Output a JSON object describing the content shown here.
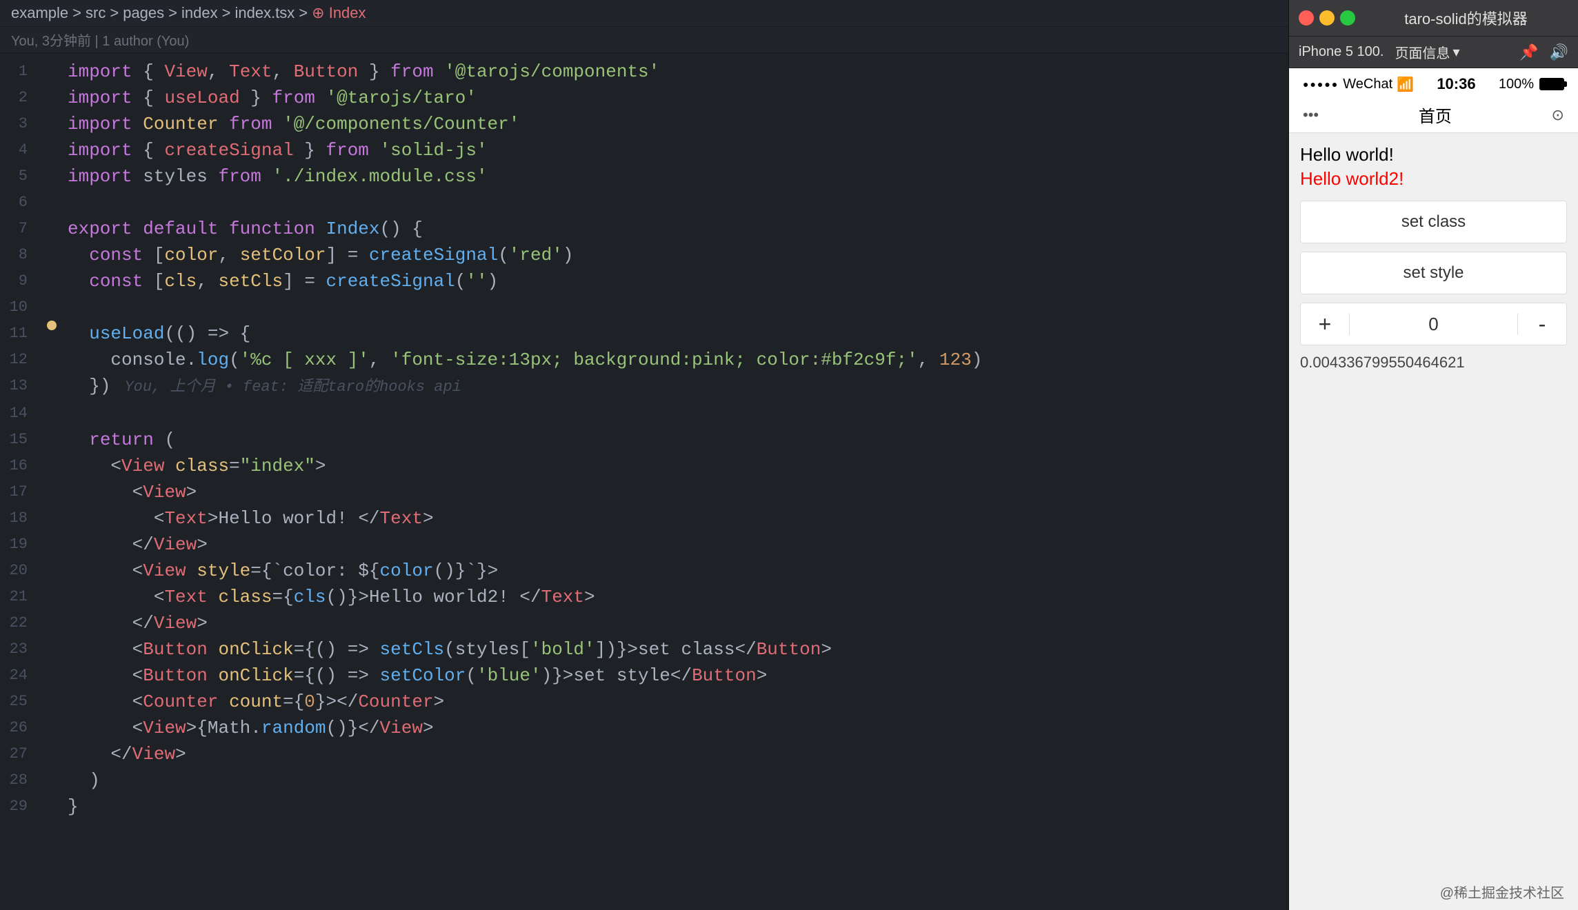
{
  "editor": {
    "breadcrumb": {
      "parts": [
        "example",
        "src",
        "pages",
        "index",
        "index.tsx",
        "Index"
      ],
      "active": "Index"
    },
    "git_info": "You, 3分钟前 | 1 author (You)",
    "lines": [
      {
        "num": "",
        "content": "import { View, Text, Button } from '@tarojs/components'",
        "type": "import"
      },
      {
        "num": "",
        "content": "import { useLoad } from '@tarojs/taro'",
        "type": "import"
      },
      {
        "num": "",
        "content": "import Counter from '@/components/Counter'",
        "type": "import"
      },
      {
        "num": "",
        "content": "import { createSignal } from 'solid-js'",
        "type": "import"
      },
      {
        "num": "",
        "content": "import styles from './index.module.css'",
        "type": "import"
      },
      {
        "num": "",
        "content": "",
        "type": "empty"
      },
      {
        "num": "",
        "content": "export default function Index() {",
        "type": "code"
      },
      {
        "num": "",
        "content": "  const [color, setColor] = createSignal('red')",
        "type": "code"
      },
      {
        "num": "",
        "content": "  const [cls, setCls] = createSignal('')",
        "type": "code"
      },
      {
        "num": "",
        "content": "",
        "type": "empty"
      },
      {
        "num": "",
        "content": "  useLoad(() => {",
        "type": "code",
        "has_dot": true
      },
      {
        "num": "",
        "content": "    console.log('%c [ xxx ]', 'font-size:13px; background:pink; color:#bf2c9f;', 123)",
        "type": "code"
      },
      {
        "num": "",
        "content": "  })",
        "type": "code",
        "blame": "You, 上个月 • feat: 适配taro的hooks api"
      },
      {
        "num": "",
        "content": "",
        "type": "empty"
      },
      {
        "num": "",
        "content": "  return (",
        "type": "code"
      },
      {
        "num": "",
        "content": "    <View class=\"index\">",
        "type": "jsx"
      },
      {
        "num": "",
        "content": "      <View>",
        "type": "jsx"
      },
      {
        "num": "",
        "content": "        <Text>Hello world! </Text>",
        "type": "jsx"
      },
      {
        "num": "",
        "content": "      </View>",
        "type": "jsx"
      },
      {
        "num": "",
        "content": "      <View style={`color: ${color()}`}>",
        "type": "jsx"
      },
      {
        "num": "",
        "content": "        <Text class={cls()}>Hello world2! </Text>",
        "type": "jsx"
      },
      {
        "num": "",
        "content": "      </View>",
        "type": "jsx"
      },
      {
        "num": "",
        "content": "      <Button onClick={() => setCls(styles['bold'])}>set class</Button>",
        "type": "jsx"
      },
      {
        "num": "",
        "content": "      <Button onClick={() => setColor('blue')}>set style</Button>",
        "type": "jsx"
      },
      {
        "num": "",
        "content": "      <Counter count={0}></Counter>",
        "type": "jsx"
      },
      {
        "num": "",
        "content": "      <View>{Math.random()}</View>",
        "type": "jsx"
      },
      {
        "num": "",
        "content": "    </View>",
        "type": "jsx"
      },
      {
        "num": "",
        "content": "  )",
        "type": "code"
      },
      {
        "num": "",
        "content": "}",
        "type": "code"
      }
    ]
  },
  "simulator": {
    "title": "taro-solid的模拟器",
    "device": "iPhone 5 100.",
    "page_info_label": "页面信息",
    "status_bar": {
      "signal": "●●●●●",
      "carrier": "WeChat",
      "wifi": "WiFi",
      "time": "10:36",
      "battery_pct": "100%"
    },
    "nav": {
      "title": "首页"
    },
    "content": {
      "hello1": "Hello world!",
      "hello2": "Hello world2!",
      "btn1": "set class",
      "btn2": "set style",
      "counter_minus": "-",
      "counter_value": "0",
      "counter_plus": "+",
      "math_random": "0.004336799550464621"
    }
  },
  "watermark": "@稀土掘金技术社区"
}
